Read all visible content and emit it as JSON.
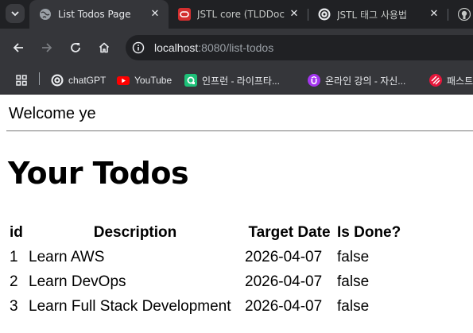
{
  "browser": {
    "tabs": [
      {
        "title": "List Todos Page",
        "active": true,
        "icon": "globe-icon"
      },
      {
        "title": "JSTL core (TLDDoc",
        "active": false,
        "icon": "oracle-icon"
      },
      {
        "title": "JSTL 태그 사용법",
        "active": false,
        "icon": "chatgpt-icon"
      },
      {
        "title": "",
        "active": false,
        "icon": "github-icon"
      }
    ],
    "address": {
      "host": "localhost",
      "rest": ":8080/list-todos"
    },
    "bookmarks": [
      {
        "label": "chatGPT",
        "icon": "chatgpt-icon"
      },
      {
        "label": "YouTube",
        "icon": "youtube-icon"
      },
      {
        "label": "인프런 - 라이프타...",
        "icon": "inflearn-icon"
      },
      {
        "label": "온라인 강의 - 자신...",
        "icon": "udemy-icon"
      },
      {
        "label": "패스트",
        "icon": "fastcampus-icon"
      }
    ],
    "colors": {
      "tabstrip": "#202124",
      "toolbar": "#35363a",
      "omnibox": "#202124"
    }
  },
  "page": {
    "welcome": "Welcome ye",
    "heading": "Your Todos",
    "table": {
      "headers": [
        "id",
        "Description",
        "Target Date",
        "Is Done?"
      ],
      "rows": [
        {
          "id": "1",
          "description": "Learn AWS",
          "target_date": "2026-04-07",
          "done": "false"
        },
        {
          "id": "2",
          "description": "Learn DevOps",
          "target_date": "2026-04-07",
          "done": "false"
        },
        {
          "id": "3",
          "description": "Learn Full Stack Development",
          "target_date": "2026-04-07",
          "done": "false"
        }
      ]
    }
  }
}
